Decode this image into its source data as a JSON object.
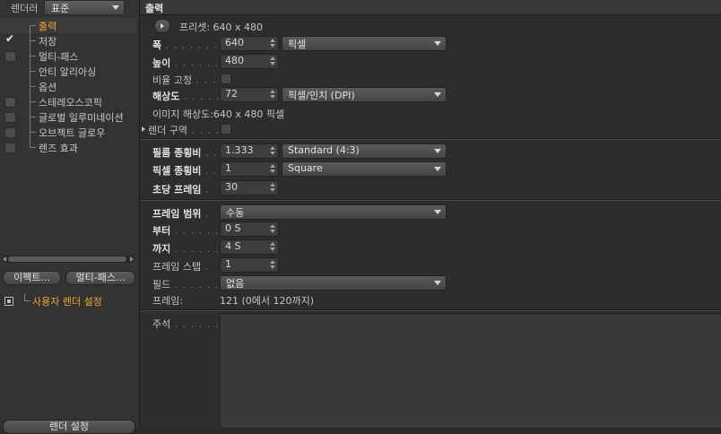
{
  "sidebar": {
    "renderer_label": "렌더러",
    "renderer_value": "표준",
    "items": [
      {
        "label": "출력",
        "selected": true,
        "checkbox": false,
        "checked": false
      },
      {
        "label": "저장",
        "selected": false,
        "checkbox": false,
        "checked": true
      },
      {
        "label": "멀티-패스",
        "selected": false,
        "checkbox": true,
        "checked": false
      },
      {
        "label": "안티 알리아싱",
        "selected": false,
        "checkbox": false,
        "checked": false
      },
      {
        "label": "옵션",
        "selected": false,
        "checkbox": false,
        "checked": false
      },
      {
        "label": "스테레오스코픽",
        "selected": false,
        "checkbox": true,
        "checked": false
      },
      {
        "label": "글로벌 일루미네이션",
        "selected": false,
        "checkbox": true,
        "checked": false
      },
      {
        "label": "오브젝트 글로우",
        "selected": false,
        "checkbox": true,
        "checked": false
      },
      {
        "label": "렌즈 효과",
        "selected": false,
        "checkbox": true,
        "checked": false
      }
    ],
    "effect_button": "이펙트...",
    "multipass_button": "멀티-패스...",
    "custom_setting": "사용자 렌더 설정",
    "bottom_button": "렌더 설정"
  },
  "main": {
    "header": "출력",
    "preset_label": "프리셋: 640 x 480",
    "width_label": "폭",
    "width_value": "640",
    "width_unit": "픽셀",
    "height_label": "높이",
    "height_value": "480",
    "lock_ratio_label": "비율 고정",
    "resolution_label": "해상도",
    "resolution_value": "72",
    "resolution_unit": "픽셀/인치 (DPI)",
    "image_resolution": "이미지 해상도:640 x 480 픽셀",
    "render_region_label": "렌더 구역",
    "film_aspect_label": "필름 종횡비",
    "film_aspect_value": "1.333",
    "film_aspect_preset": "Standard (4:3)",
    "pixel_aspect_label": "픽셀 종횡비",
    "pixel_aspect_value": "1",
    "pixel_aspect_preset": "Square",
    "fps_label": "초당 프레임",
    "fps_value": "30",
    "frame_range_label": "프레임 범위",
    "frame_range_value": "수동",
    "from_label": "부터",
    "from_value": "0 S",
    "to_label": "까지",
    "to_value": "4 S",
    "frame_step_label": "프레임 스텝",
    "frame_step_value": "1",
    "field_label": "필드",
    "field_value": "없음",
    "frames_label": "프레임:",
    "frames_value": "121 (0에서 120까지)",
    "notes_label": "주석"
  }
}
